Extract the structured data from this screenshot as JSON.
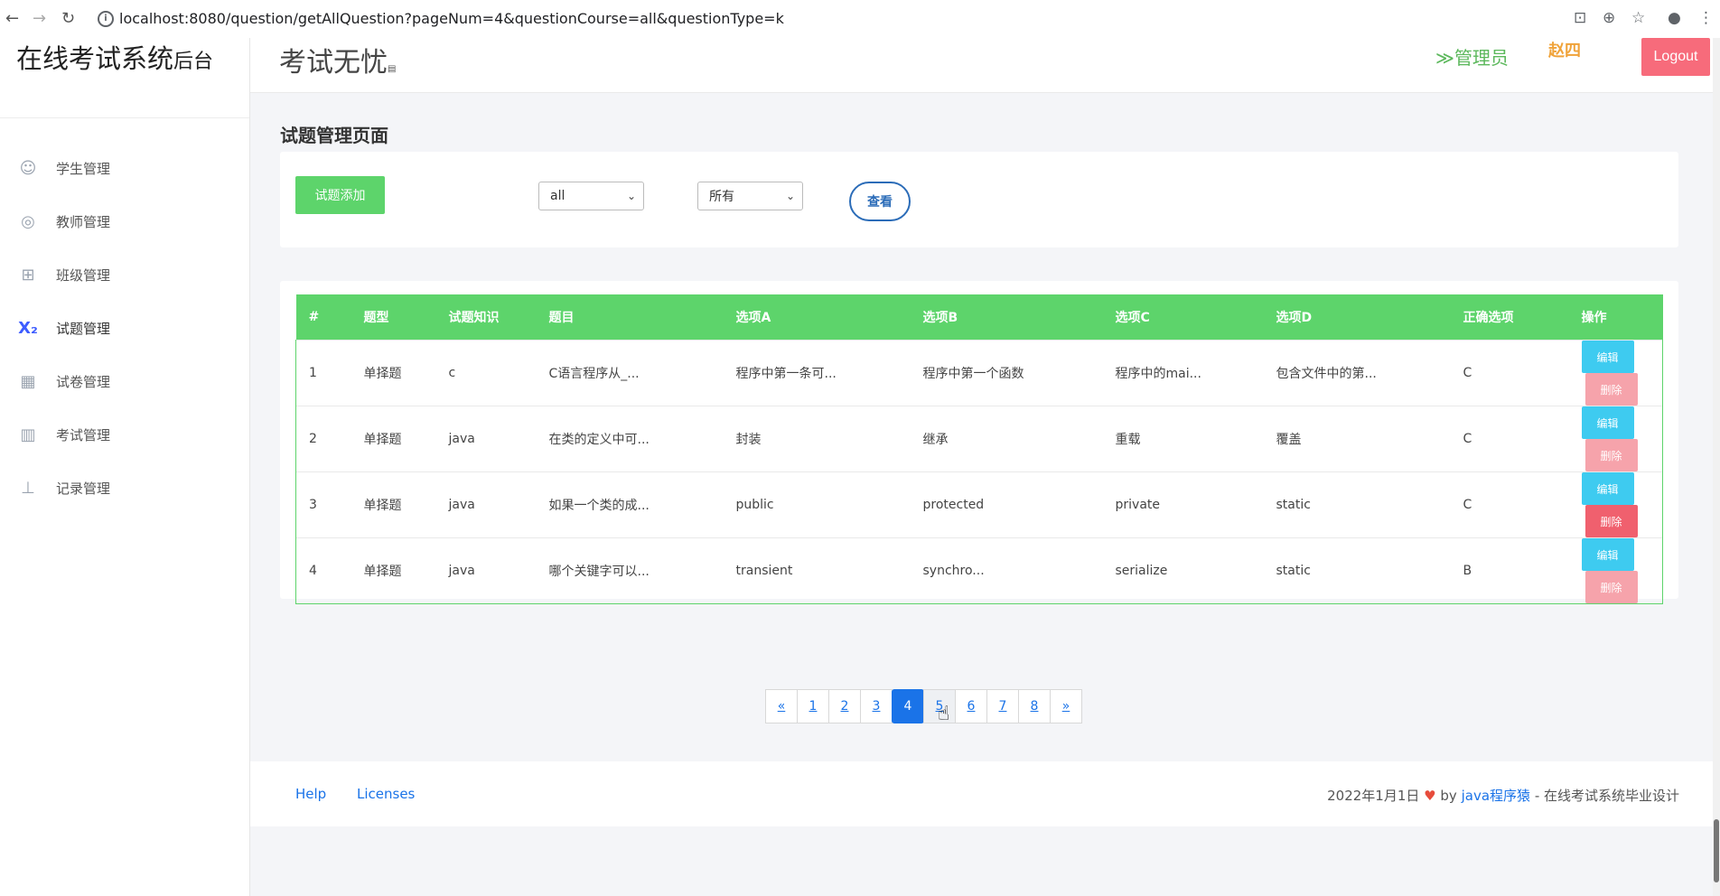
{
  "browser": {
    "url": "localhost:8080/question/getAllQuestion?pageNum=4&questionCourse=all&questionType=k",
    "back_icon": "←",
    "forward_icon": "→",
    "reload_icon": "↻"
  },
  "sidebar": {
    "brand_main": "在线考试系统",
    "brand_small": "后台",
    "items": [
      {
        "label": "学生管理",
        "icon": "☺"
      },
      {
        "label": "教师管理",
        "icon": "◎"
      },
      {
        "label": "班级管理",
        "icon": "⊞"
      },
      {
        "label": "试题管理",
        "icon": "X₂"
      },
      {
        "label": "试卷管理",
        "icon": "▦"
      },
      {
        "label": "考试管理",
        "icon": "▥"
      },
      {
        "label": "记录管理",
        "icon": "⊥"
      }
    ]
  },
  "header": {
    "title": "考试无忧",
    "title_suffix": "▤",
    "role": "≫管理员",
    "user": "赵四",
    "logout": "Logout"
  },
  "content": {
    "page_title": "试题管理页面",
    "add_button": "试题添加",
    "course_select": "all",
    "type_select": "所有",
    "view_button": "查看"
  },
  "table": {
    "headers": [
      "#",
      "题型",
      "试题知识",
      "题目",
      "选项A",
      "选项B",
      "选项C",
      "选项D",
      "正确选项",
      "操作"
    ],
    "rows": [
      {
        "id": "1",
        "type": "单择题",
        "knowledge": "c",
        "question": "C语言程序从_...",
        "a": "程序中第一条可...",
        "b": "程序中第一个函数",
        "c": "程序中的mai...",
        "d": "包含文件中的第...",
        "answer": "C"
      },
      {
        "id": "2",
        "type": "单择题",
        "knowledge": "java",
        "question": "在类的定义中可...",
        "a": "封装",
        "b": "继承",
        "c": "重载",
        "d": "覆盖",
        "answer": "C"
      },
      {
        "id": "3",
        "type": "单择题",
        "knowledge": "java",
        "question": "如果一个类的成...",
        "a": "public",
        "b": "protected",
        "c": "private",
        "d": "static",
        "answer": "C"
      },
      {
        "id": "4",
        "type": "单择题",
        "knowledge": "java",
        "question": "哪个关键字可以...",
        "a": "transient",
        "b": "synchro...",
        "c": "serialize",
        "d": "static",
        "answer": "B"
      }
    ],
    "edit_label": "编辑",
    "delete_label": "删除"
  },
  "pagination": {
    "prev": "«",
    "pages": [
      "1",
      "2",
      "3",
      "4",
      "5",
      "6",
      "7",
      "8"
    ],
    "current": "4",
    "next": "»"
  },
  "footer": {
    "help": "Help",
    "licenses": "Licenses",
    "date": "2022年1月1日",
    "by": "by",
    "author": "java程序猿",
    "tail": "- 在线考试系统毕业设计"
  }
}
